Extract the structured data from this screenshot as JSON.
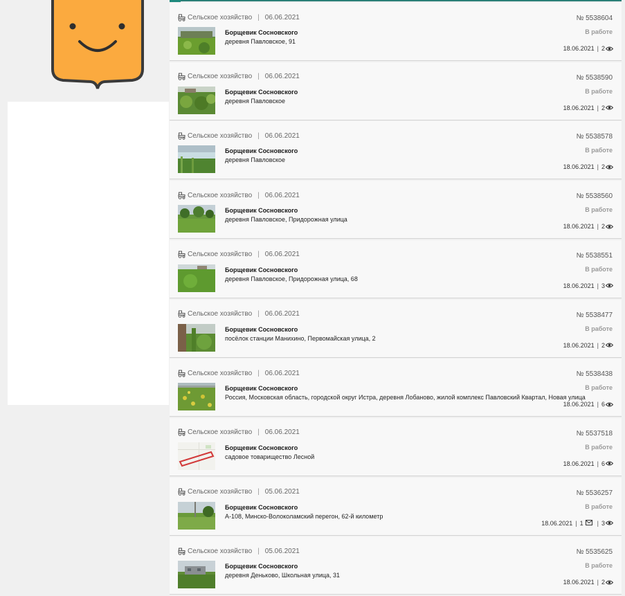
{
  "feed": {
    "items": [
      {
        "category": "Сельское хозяйство",
        "date": "06.06.2021",
        "title": "Борщевик Сосновского",
        "address": "деревня Павловское, 91",
        "number": "№ 5538604",
        "status": "В работе",
        "updated": "18.06.2021",
        "messages": "",
        "views": "2",
        "thumb": "field"
      },
      {
        "category": "Сельское хозяйство",
        "date": "06.06.2021",
        "title": "Борщевик Сосновского",
        "address": "деревня Павловское",
        "number": "№ 5538590",
        "status": "В работе",
        "updated": "18.06.2021",
        "messages": "",
        "views": "2",
        "thumb": "bushes"
      },
      {
        "category": "Сельское хозяйство",
        "date": "06.06.2021",
        "title": "Борщевик Сосновского",
        "address": "деревня Павловское",
        "number": "№ 5538578",
        "status": "В работе",
        "updated": "18.06.2021",
        "messages": "",
        "views": "2",
        "thumb": "river"
      },
      {
        "category": "Сельское хозяйство",
        "date": "06.06.2021",
        "title": "Борщевик Сосновского",
        "address": "деревня Павловское, Придорожная улица",
        "number": "№ 5538560",
        "status": "В работе",
        "updated": "18.06.2021",
        "messages": "",
        "views": "2",
        "thumb": "trees"
      },
      {
        "category": "Сельское хозяйство",
        "date": "06.06.2021",
        "title": "Борщевик Сосновского",
        "address": "деревня Павловское, Придорожная улица, 68",
        "number": "№ 5538551",
        "status": "В работе",
        "updated": "18.06.2021",
        "messages": "",
        "views": "3",
        "thumb": "meadow"
      },
      {
        "category": "Сельское хозяйство",
        "date": "06.06.2021",
        "title": "Борщевик Сосновского",
        "address": "посёлок станции Манихино, Первомайская улица, 2",
        "number": "№ 5538477",
        "status": "В работе",
        "updated": "18.06.2021",
        "messages": "",
        "views": "2",
        "thumb": "fence"
      },
      {
        "category": "Сельское хозяйство",
        "date": "06.06.2021",
        "title": "Борщевик Сосновского",
        "address": "Россия, Московская область, городской округ Истра, деревня Лобаново, жилой комплекс Павловский Квартал, Новая улица",
        "number": "№ 5538438",
        "status": "В работе",
        "updated": "18.06.2021",
        "messages": "",
        "views": "6",
        "thumb": "yellow"
      },
      {
        "category": "Сельское хозяйство",
        "date": "06.06.2021",
        "title": "Борщевик Сосновского",
        "address": "садовое товарищество Лесной",
        "number": "№ 5537518",
        "status": "В работе",
        "updated": "18.06.2021",
        "messages": "",
        "views": "6",
        "thumb": "map"
      },
      {
        "category": "Сельское хозяйство",
        "date": "05.06.2021",
        "title": "Борщевик Сосновского",
        "address": "А-108, Минско-Волоколамский перегон, 62-й километр",
        "number": "№ 5536257",
        "status": "В работе",
        "updated": "18.06.2021",
        "messages": "1",
        "views": "3",
        "thumb": "pole"
      },
      {
        "category": "Сельское хозяйство",
        "date": "05.06.2021",
        "title": "Борщевик Сосновского",
        "address": "деревня Деньково, Школьная улица, 31",
        "number": "№ 5535625",
        "status": "В работе",
        "updated": "18.06.2021",
        "messages": "",
        "views": "2",
        "thumb": "house"
      }
    ]
  },
  "colors": {
    "emblem_fill": "#fbaa3f",
    "emblem_stroke": "#3a3a3a",
    "accent": "#1f8a7e",
    "status_text": "#9a9a9a"
  },
  "icons": {
    "category": "tractor-icon",
    "views": "eye-icon",
    "messages": "mail-icon"
  }
}
